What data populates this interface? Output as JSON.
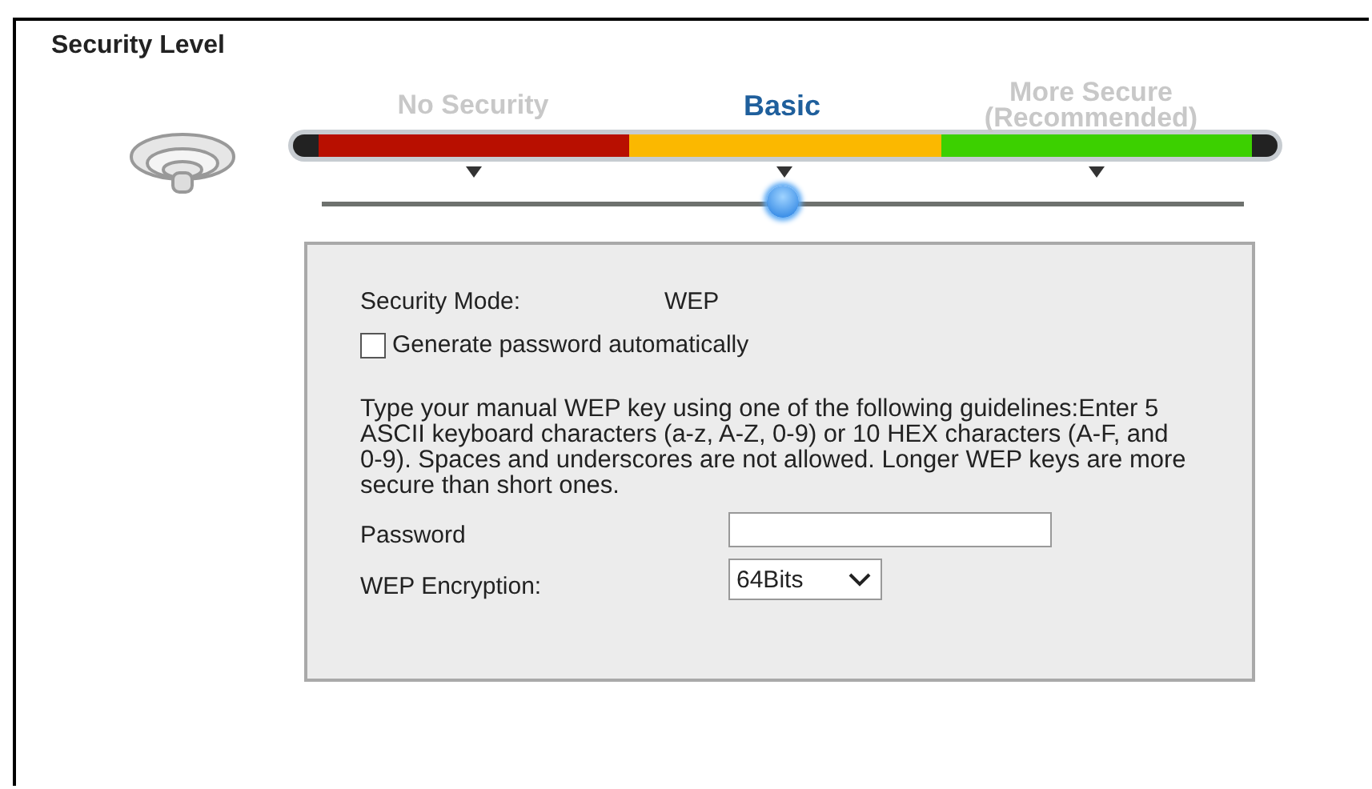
{
  "title": "Security Level",
  "levels": [
    {
      "label": "No Security",
      "selected": false,
      "color": "#b80f00"
    },
    {
      "label": "Basic",
      "selected": true,
      "color": "#fbb800"
    },
    {
      "label": "More Secure\n(Recommended)",
      "selected": false,
      "color": "#3cd000"
    }
  ],
  "slider": {
    "level": 0.5
  },
  "panel": {
    "mode_label": "Security Mode:",
    "mode_value": "WEP",
    "auto_password": {
      "label": "Generate password automatically",
      "checked": false
    },
    "guidelines": "Type your manual WEP key using one of the following guidelines:Enter 5 ASCII keyboard characters (a-z, A-Z, 0-9) or 10 HEX characters (A-F, and 0-9). Spaces and underscores are not allowed. Longer WEP keys are more secure than short ones.",
    "password_label": "Password",
    "encryption_label": "WEP Encryption:",
    "encryption_value": "64Bits"
  }
}
